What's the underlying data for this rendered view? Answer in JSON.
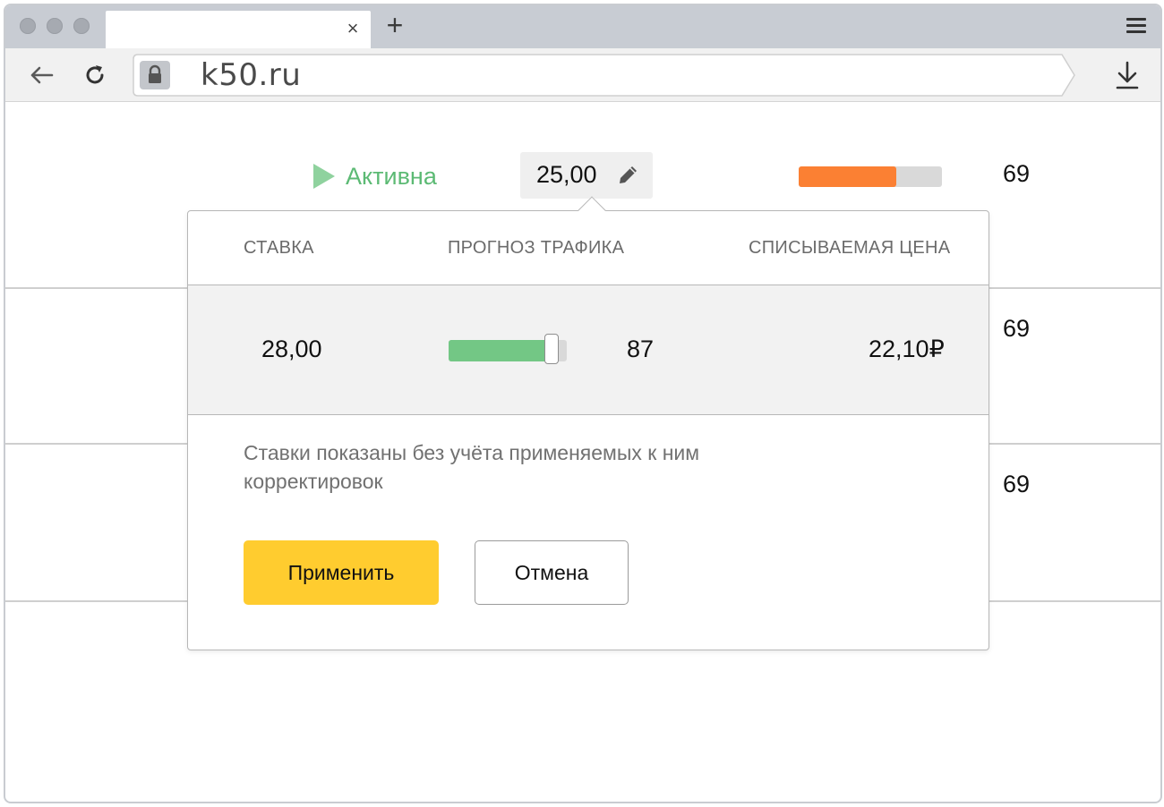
{
  "browser": {
    "url": "k50.ru",
    "tab_close_glyph": "×",
    "new_tab_glyph": "+",
    "icons": [
      "back-arrow-icon",
      "reload-icon",
      "lock-icon",
      "download-icon",
      "menu-icon",
      "pencil-icon"
    ]
  },
  "table": {
    "status_label": "Активна",
    "current_bid": "25,00",
    "traffic_progress_fraction": 0.68,
    "row_values": [
      "69",
      "69",
      "69"
    ]
  },
  "popup": {
    "headers": {
      "bid": "СТАВКА",
      "traffic": "ПРОГНОЗ ТРАФИКА",
      "price": "СПИСЫВАЕМАЯ ЦЕНА"
    },
    "row": {
      "bid": "28,00",
      "traffic_value": "87",
      "traffic_slider_fraction": 0.87,
      "price": "22,10₽"
    },
    "note": "Ставки показаны без учёта применяемых к ним корректировок",
    "apply_label": "Применить",
    "cancel_label": "Отмена"
  },
  "colors": {
    "active_green": "#5cba74",
    "progress_orange": "#fb8033",
    "slider_green": "#73c785",
    "apply_yellow": "#ffcc2f"
  }
}
